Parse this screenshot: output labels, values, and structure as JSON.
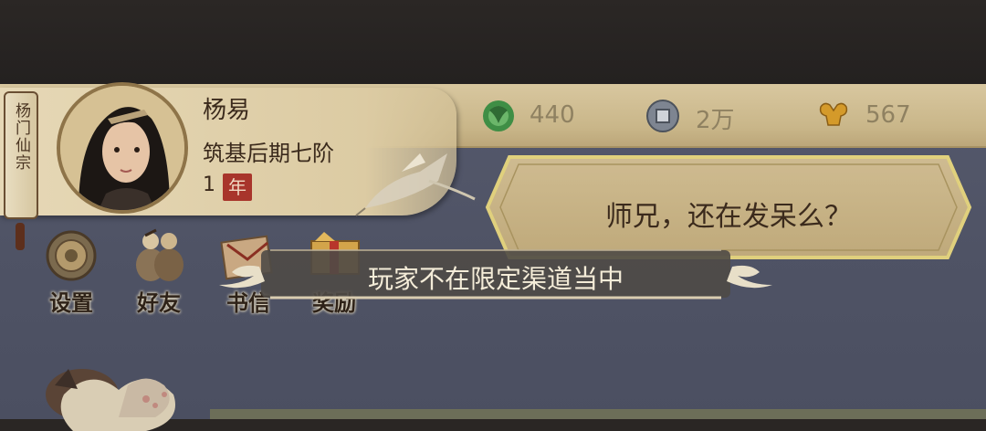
{
  "sect": {
    "label": "杨门仙宗"
  },
  "player": {
    "name": "杨易",
    "realm": "筑基后期七阶",
    "years_count": "1",
    "years_unit": "年"
  },
  "currencies": [
    {
      "icon": "jade-icon",
      "value": "440"
    },
    {
      "icon": "coin-icon",
      "value": "2万"
    },
    {
      "icon": "strength-icon",
      "value": "567"
    }
  ],
  "speech": {
    "text": "师兄，还在发呆么？"
  },
  "menu": [
    {
      "icon": "settings-icon",
      "label": "设置"
    },
    {
      "icon": "friends-icon",
      "label": "好友"
    },
    {
      "icon": "letter-icon",
      "label": "书信"
    },
    {
      "icon": "gift-icon",
      "label": "奖励"
    }
  ],
  "toast": {
    "text": "玩家不在限定渠道当中"
  },
  "colors": {
    "parchment": "#dccba3",
    "ink": "#3b2a1c",
    "toast_bg": "#5a5550",
    "scene": "#4f5365",
    "year_badge": "#a8352b"
  }
}
